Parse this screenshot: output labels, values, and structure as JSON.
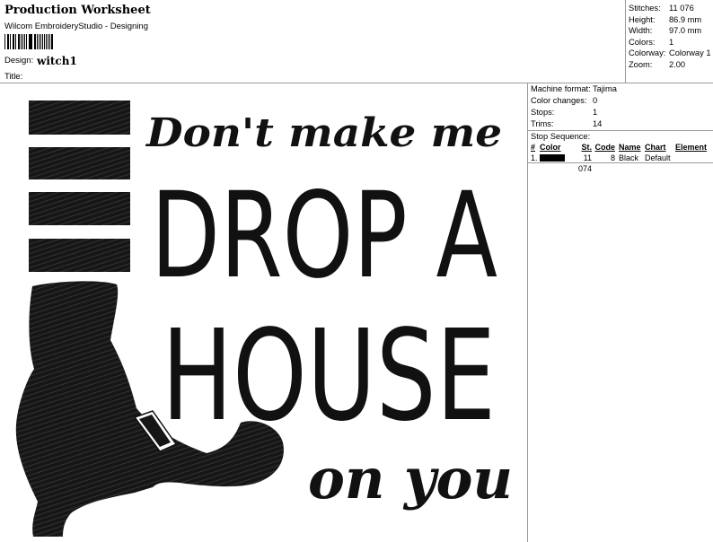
{
  "header": {
    "title": "Production Worksheet",
    "app": "Wilcom EmbroideryStudio - Designing",
    "design_label": "Design:",
    "design_value": "witch1",
    "title_label": "Title:"
  },
  "info": [
    {
      "key": "Stitches:",
      "value": "11 076"
    },
    {
      "key": "Height:",
      "value": "86.9 mm"
    },
    {
      "key": "Width:",
      "value": "97.0 mm"
    },
    {
      "key": "Colors:",
      "value": "1"
    },
    {
      "key": "Colorway:",
      "value": "Colorway 1"
    },
    {
      "key": "Zoom:",
      "value": "2.00"
    }
  ],
  "machine": [
    {
      "key": "Machine format:",
      "value": "Tajima"
    },
    {
      "key": "Color changes:",
      "value": "0"
    },
    {
      "key": "Stops:",
      "value": "1"
    },
    {
      "key": "Trims:",
      "value": "14"
    }
  ],
  "stop_sequence": {
    "title": "Stop Sequence:",
    "headers": [
      "#",
      "Color",
      "St.",
      "Code",
      "Name",
      "Chart",
      "Element"
    ],
    "rows": [
      {
        "num": "1.",
        "color": "#000000",
        "stitches": "11 074",
        "code": "8",
        "name": "Black",
        "chart": "Default",
        "element": ""
      }
    ]
  },
  "design": {
    "line1": "Don't make me",
    "line2": "DROP A",
    "line3": "HOUSE",
    "line4": "on you",
    "thread_color": "#111111"
  }
}
